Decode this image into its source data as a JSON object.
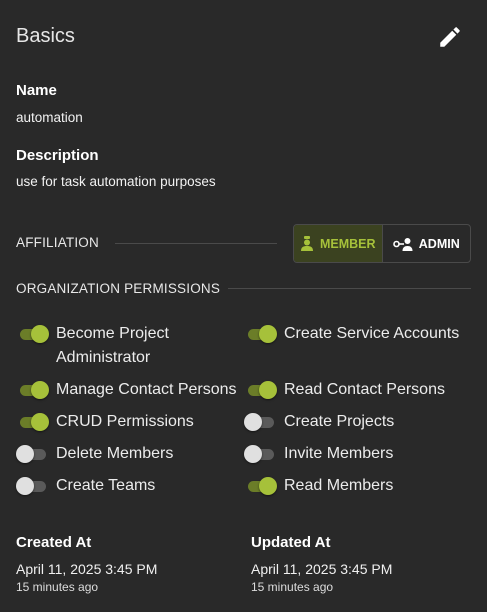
{
  "header": {
    "title": "Basics",
    "edit_icon": "pencil-icon"
  },
  "name": {
    "label": "Name",
    "value": "automation"
  },
  "description": {
    "label": "Description",
    "value": "use for task automation purposes"
  },
  "affiliation": {
    "label": "AFFILIATION",
    "options": [
      {
        "label": "MEMBER",
        "icon": "member-badge-icon",
        "selected": true
      },
      {
        "label": "ADMIN",
        "icon": "admin-key-icon",
        "selected": false
      }
    ],
    "accent_color": "#a6c13a"
  },
  "permissions": {
    "label": "ORGANIZATION PERMISSIONS",
    "items": [
      {
        "label": "Become Project Administrator",
        "label_line1": "Become Project",
        "label_line2": "Administrator",
        "enabled": true
      },
      {
        "label": "Create Service Accounts",
        "enabled": true
      },
      {
        "label": "Manage Contact Persons",
        "enabled": true
      },
      {
        "label": "Read Contact Persons",
        "enabled": true
      },
      {
        "label": "CRUD Permissions",
        "enabled": true
      },
      {
        "label": "Create Projects",
        "enabled": false
      },
      {
        "label": "Delete Members",
        "enabled": false
      },
      {
        "label": "Invite Members",
        "enabled": false
      },
      {
        "label": "Create Teams",
        "enabled": false
      },
      {
        "label": "Read Members",
        "enabled": true
      }
    ]
  },
  "created": {
    "label": "Created At",
    "date": "April 11, 2025 3:45 PM",
    "relative": "15 minutes ago"
  },
  "updated": {
    "label": "Updated At",
    "date": "April 11, 2025 3:45 PM",
    "relative": "15 minutes ago"
  }
}
